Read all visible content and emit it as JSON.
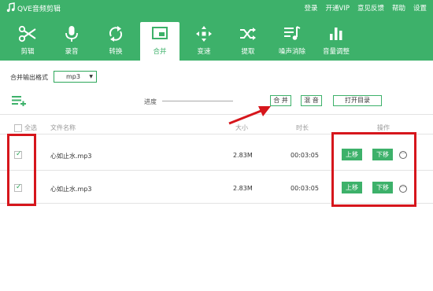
{
  "app": {
    "title": "QVE音频剪辑"
  },
  "top_menu": [
    "登录",
    "开通VIP",
    "意见反馈",
    "帮助",
    "设置"
  ],
  "toolbar": {
    "active": "合并",
    "items": [
      {
        "label": "剪辑",
        "icon": "scissors-icon"
      },
      {
        "label": "录音",
        "icon": "microphone-icon"
      },
      {
        "label": "转换",
        "icon": "convert-arrows-icon"
      },
      {
        "label": "合并",
        "icon": "merge-window-icon"
      },
      {
        "label": "变速",
        "icon": "speed-dpad-icon"
      },
      {
        "label": "提取",
        "icon": "shuffle-icon"
      },
      {
        "label": "噪声消除",
        "icon": "noise-removal-icon"
      },
      {
        "label": "音量调整",
        "icon": "volume-bars-icon"
      }
    ]
  },
  "merge_panel": {
    "format_label": "合并输出格式",
    "format_value": "mp3",
    "progress_label": "进度",
    "merge_button": "合 并",
    "mix_button": "混 音",
    "open_dir_button": "打开目录"
  },
  "table": {
    "headers": {
      "select_all": "全选",
      "name": "文件名称",
      "size": "大小",
      "duration": "时长",
      "actions": "操作"
    },
    "rows": [
      {
        "checked": true,
        "name": "心如止水.mp3",
        "size": "2.83M",
        "duration": "00:03:05",
        "up": "上移",
        "down": "下移",
        "more": "···"
      },
      {
        "checked": true,
        "name": "心如止水.mp3",
        "size": "2.83M",
        "duration": "00:03:05",
        "up": "上移",
        "down": "下移",
        "more": "···"
      }
    ]
  },
  "colors": {
    "brand_green": "#3db16a",
    "annotation_red": "#d6161c"
  }
}
